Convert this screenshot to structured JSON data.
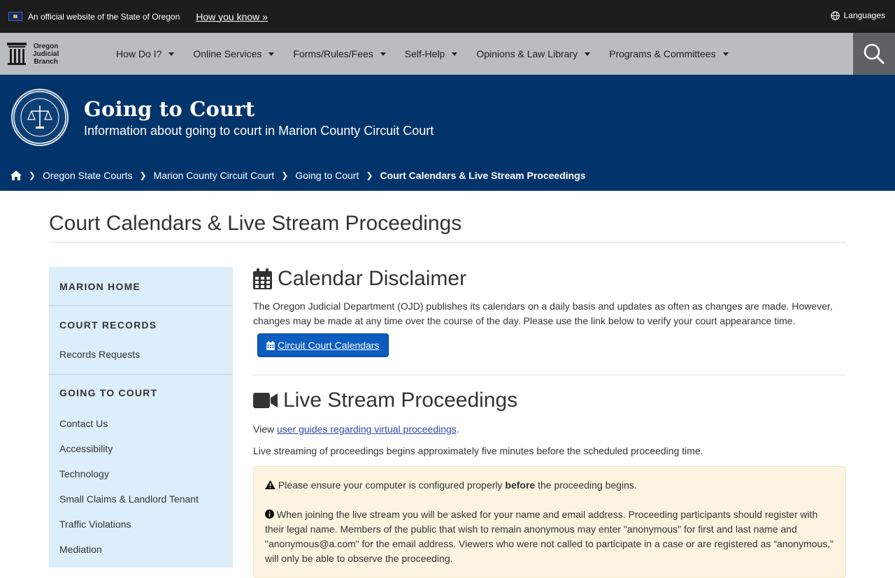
{
  "banner": {
    "official_text": "An official website of the State of Oregon",
    "how_link": "How you know »",
    "languages": "Languages"
  },
  "logo": {
    "line1": "Oregon",
    "line2": "Judicial",
    "line3": "Branch"
  },
  "nav": {
    "items": [
      {
        "label": "How Do I?"
      },
      {
        "label": "Online Services"
      },
      {
        "label": "Forms/Rules/Fees"
      },
      {
        "label": "Self-Help"
      },
      {
        "label": "Opinions & Law Library"
      },
      {
        "label": "Programs & Committees"
      }
    ]
  },
  "hero": {
    "title": "Going to Court",
    "subtitle": "Information about going to court in Marion County Circuit Court"
  },
  "breadcrumb": {
    "items": [
      "Oregon State Courts",
      "Marion County Circuit Court",
      "Going to Court"
    ],
    "current": "Court Calendars & Live Stream Proceedings"
  },
  "page": {
    "title": "Court Calendars & Live Stream Proceedings"
  },
  "sidebar": {
    "marion_home": "MARION HOME",
    "court_records": "COURT RECORDS",
    "records_requests": "Records Requests",
    "going_to_court": "GOING TO COURT",
    "links": [
      "Contact Us",
      "Accessibility",
      "Technology",
      "Small Claims & Landlord Tenant",
      "Traffic Violations",
      "Mediation"
    ]
  },
  "calendar": {
    "heading": "Calendar Disclaimer",
    "text": "The Oregon Judicial Department (OJD) publishes its calendars on a daily basis and updates as often as changes are made. However, changes may be made at any time over the course of the day. Please use the link below to verify your court appearance time.",
    "button": "Circuit Court Calendars"
  },
  "livestream": {
    "heading": "Live Stream Proceedings",
    "view_prefix": "View ",
    "view_link": "user guides regarding virtual proceedings",
    "view_suffix": ".",
    "intro": "Live streaming of proceedings begins approximately five minutes before the scheduled proceeding time.",
    "warn_pre": "Please ensure your computer is configured properly ",
    "warn_bold": "before",
    "warn_post": " the proceeding begins.",
    "info": "When joining the live stream you will be asked for your name and email address. Proceeding participants should register with their legal name. Members of the public that wish to remain anonymous may enter \"anonymous\" for first and last name and \"anonymous@a.com\" for the email address. Viewers who were not called to participate in a case or are registered as “anonymous,” will only be able to observe the proceeding."
  },
  "colors": {
    "banner_bg": "#1d1d1d",
    "nav_bg": "#b9bdc0",
    "hero_bg": "#01346b",
    "sidebar_bg": "#dcedfb",
    "button_bg": "#0b5cbf",
    "notice_bg": "#fcf4e0"
  },
  "icons": [
    "flag-icon",
    "globe-icon",
    "pillar-logo-icon",
    "search-icon",
    "seal-icon",
    "home-icon",
    "chevron-right-icon",
    "calendar-icon",
    "video-camera-icon",
    "warning-icon",
    "info-icon"
  ]
}
